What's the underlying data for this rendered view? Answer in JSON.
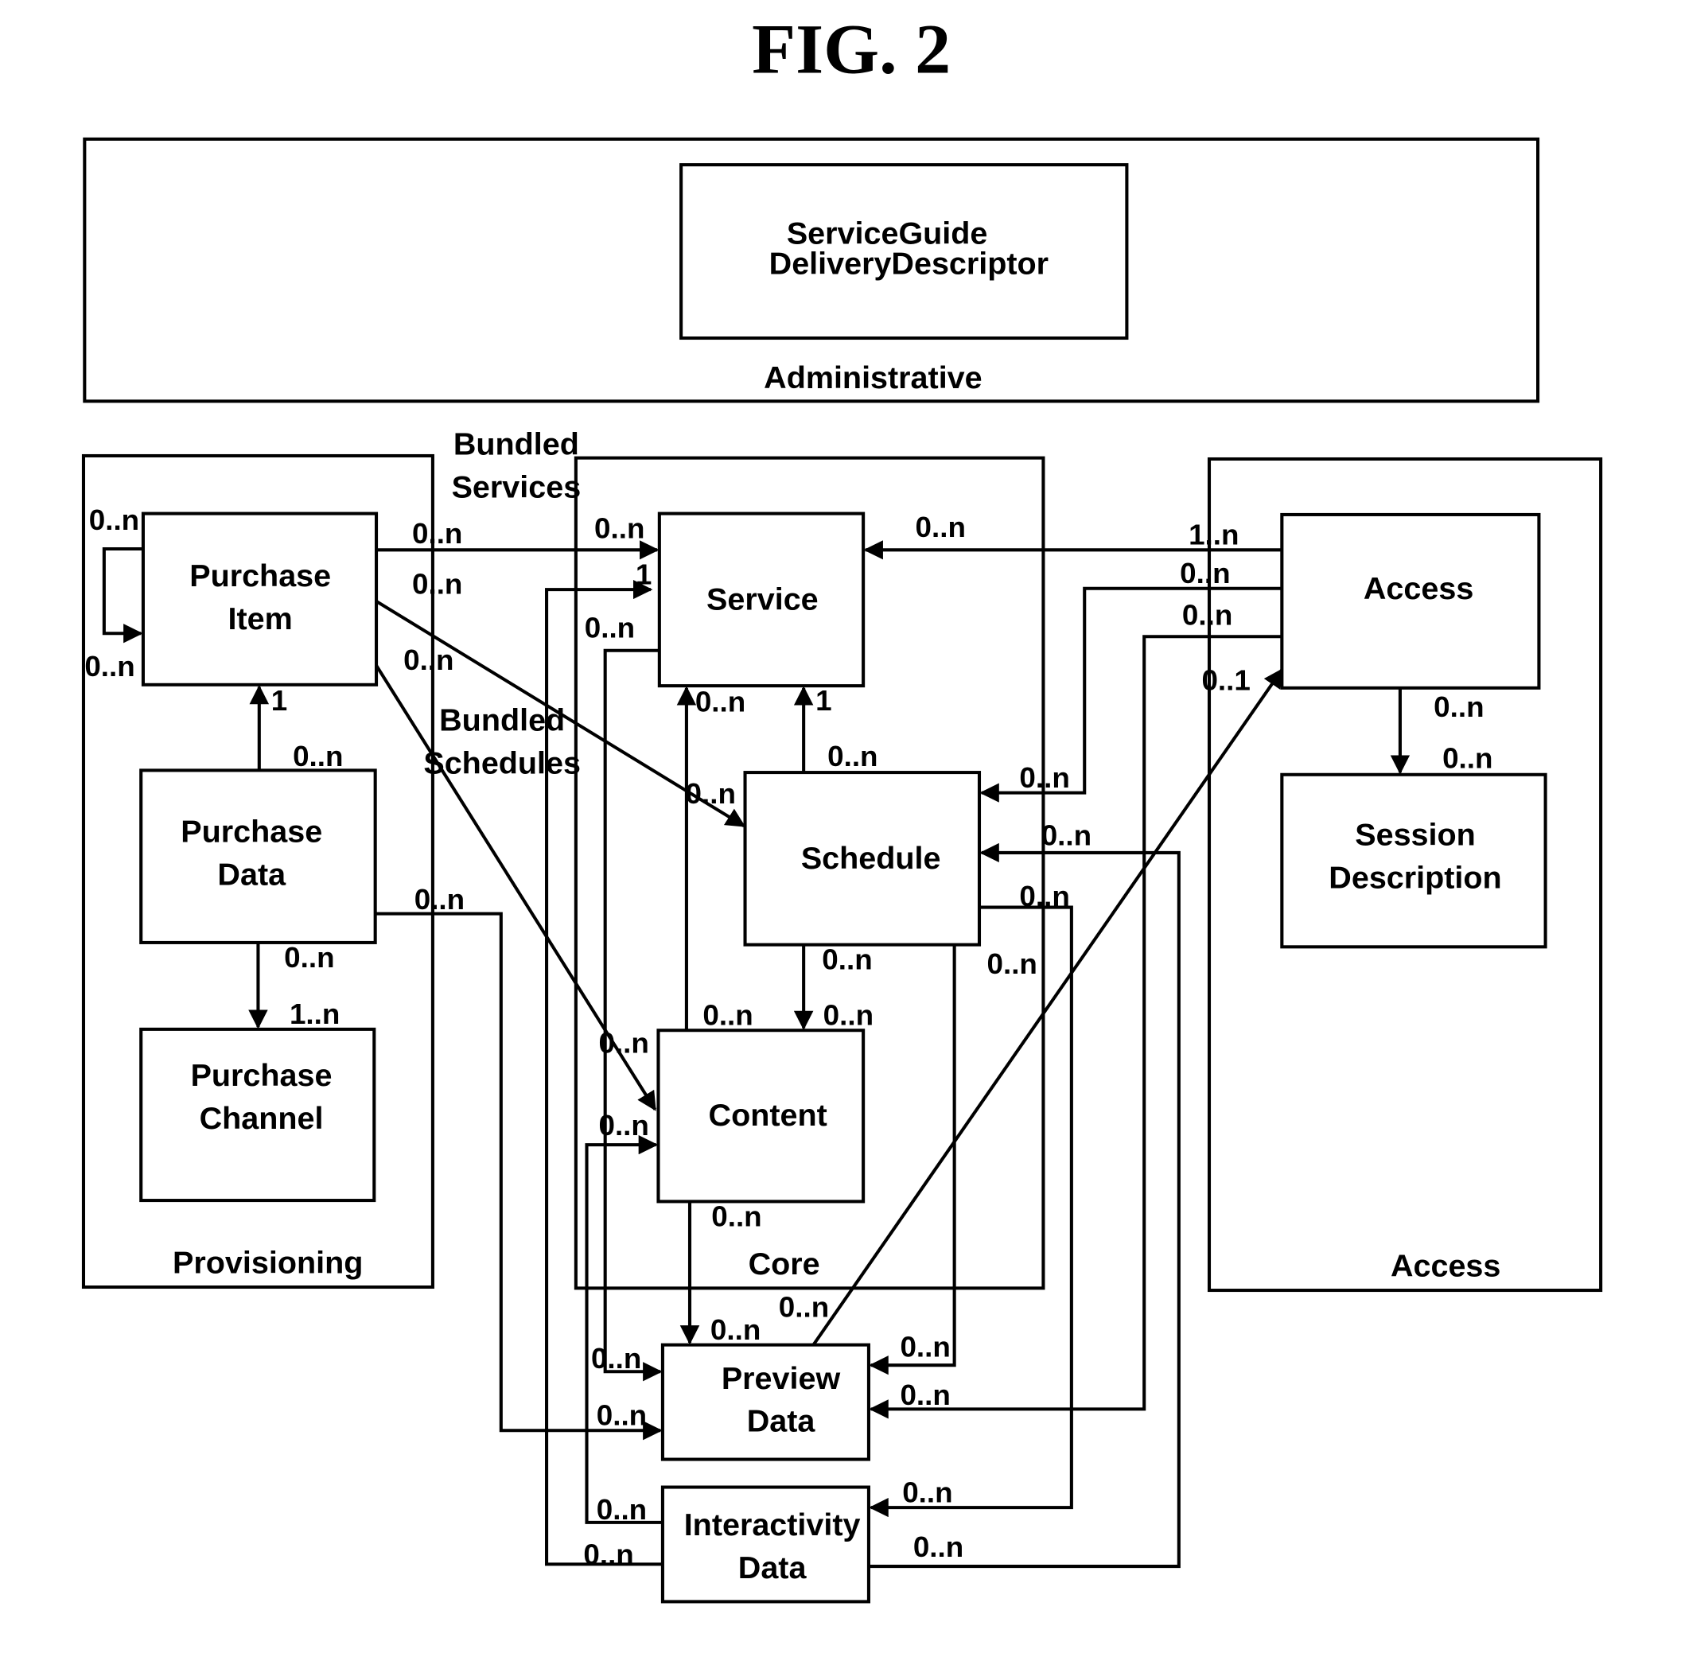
{
  "title": "FIG. 2",
  "groups": {
    "administrative": "Administrative",
    "provisioning": "Provisioning",
    "core": "Core",
    "access": "Access"
  },
  "entities": {
    "sgdd": [
      "ServiceGuide",
      "DeliveryDescriptor"
    ],
    "purchase_item": [
      "Purchase",
      "Item"
    ],
    "purchase_data": [
      "Purchase",
      "Data"
    ],
    "purchase_channel": [
      "Purchase",
      "Channel"
    ],
    "service": [
      "Service"
    ],
    "schedule": [
      "Schedule"
    ],
    "content": [
      "Content"
    ],
    "access": [
      "Access"
    ],
    "session_description": [
      "Session",
      "Description"
    ],
    "preview_data": [
      "Preview",
      "Data"
    ],
    "interactivity_data": [
      "Interactivity",
      "Data"
    ]
  },
  "annotations": {
    "bundled_services": [
      "Bundled",
      "Services"
    ],
    "bundled_schedules": [
      "Bundled",
      "Schedules"
    ]
  },
  "cardinalities": [
    "0..n",
    "0..n",
    "0..n",
    "0..n",
    "0..n",
    "1",
    "0..n",
    "0..n",
    "0..n",
    "1..n",
    "0..n",
    "0..n",
    "0..1",
    "0..n",
    "0..n",
    "1",
    "0..n",
    "1",
    "0..n",
    "0..n",
    "0..n",
    "0..n",
    "0..n",
    "0..n",
    "0..n",
    "0..n",
    "0..n",
    "1..n",
    "0..n",
    "0..n",
    "0..n",
    "0..n",
    "0..n",
    "0..n",
    "0..n",
    "0..n",
    "0..n",
    "0..n",
    "0..n",
    "0..n",
    "0..n",
    "0..n",
    "0..n",
    "0..n"
  ]
}
